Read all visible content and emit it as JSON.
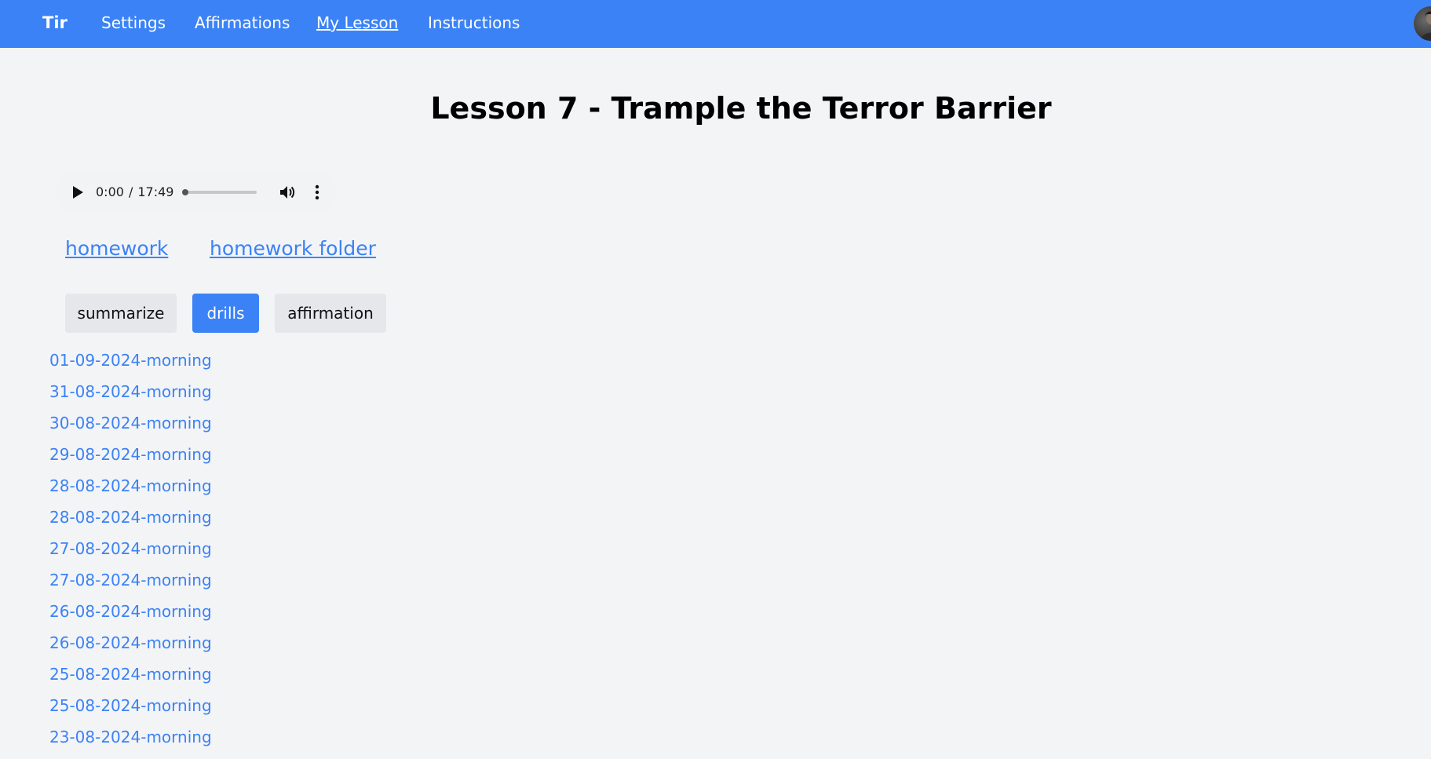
{
  "nav": {
    "brand": "Tir",
    "links": [
      {
        "label": "Settings"
      },
      {
        "label": "Affirmations"
      },
      {
        "label": "My Lesson",
        "active": true
      },
      {
        "label": "Instructions"
      }
    ]
  },
  "page": {
    "title": "Lesson 7 - Trample the Terror Barrier"
  },
  "audio": {
    "current_time": "0:00",
    "duration": "17:49",
    "progress": 0
  },
  "links": {
    "homework": "homework",
    "homework_folder": "homework folder"
  },
  "tabs": [
    {
      "label": "summarize",
      "active": false
    },
    {
      "label": "drills",
      "active": true
    },
    {
      "label": "affirmation",
      "active": false
    }
  ],
  "sessions": [
    "01-09-2024-morning",
    "31-08-2024-morning",
    "30-08-2024-morning",
    "29-08-2024-morning",
    "28-08-2024-morning",
    "28-08-2024-morning",
    "27-08-2024-morning",
    "27-08-2024-morning",
    "26-08-2024-morning",
    "26-08-2024-morning",
    "25-08-2024-morning",
    "25-08-2024-morning",
    "23-08-2024-morning"
  ],
  "colors": {
    "accent": "#3b82f6",
    "background": "#f3f4f6",
    "tab_inactive": "#e5e7eb"
  },
  "icons": {
    "play": "play-icon",
    "volume": "volume-icon",
    "more": "more-vertical-icon",
    "avatar": "user-avatar"
  }
}
